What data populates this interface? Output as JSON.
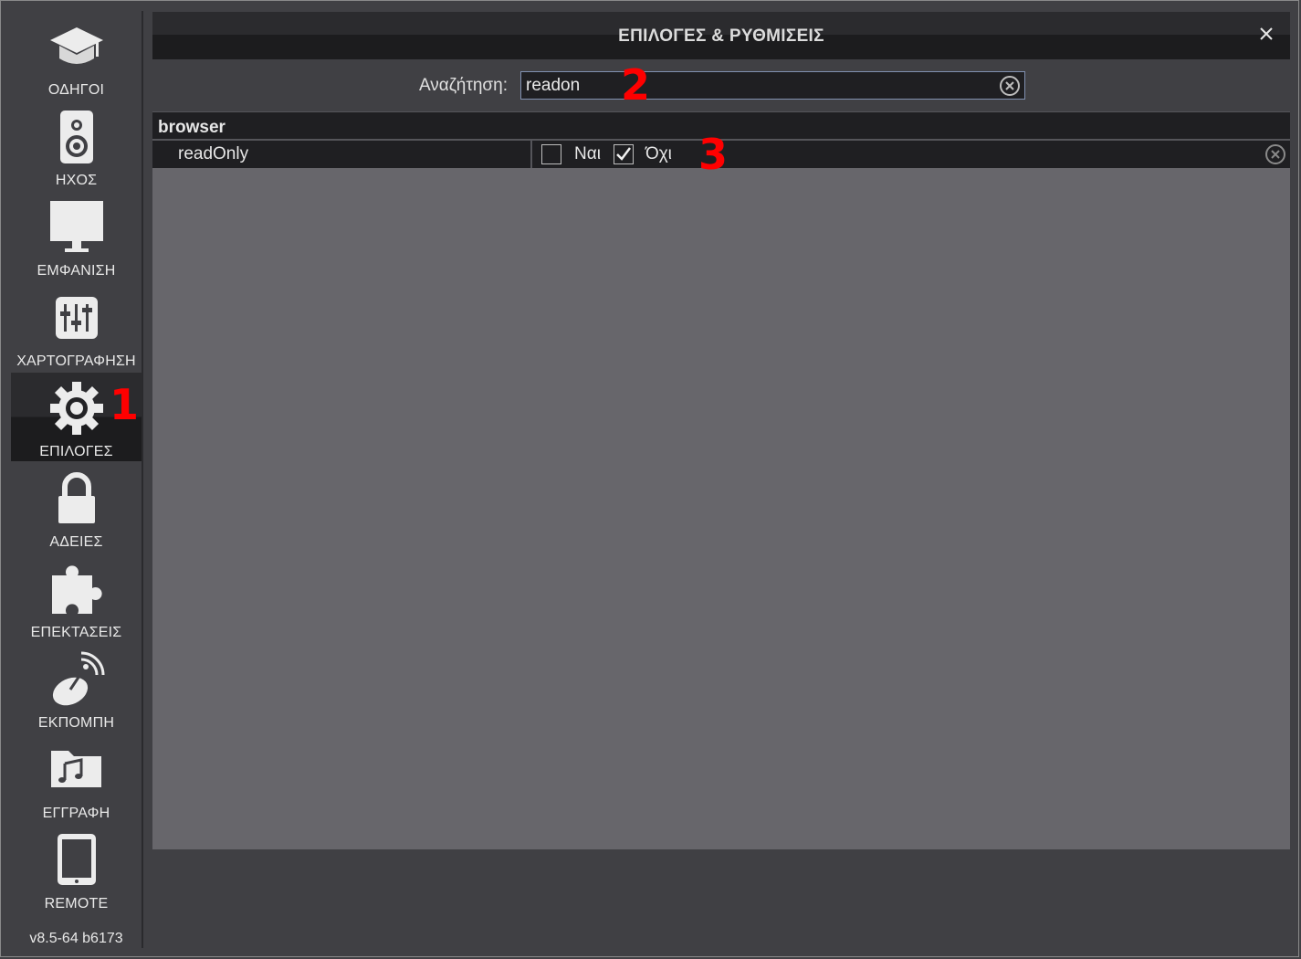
{
  "window": {
    "title": "ΕΠΙΛΟΓΕΣ & ΡΥΘΜΙΣΕΙΣ",
    "close_icon": "close-icon"
  },
  "sidebar": {
    "items": [
      {
        "label": "ΟΔΗΓΟΙ",
        "icon": "graduation-cap-icon"
      },
      {
        "label": "ΗΧΟΣ",
        "icon": "speaker-icon"
      },
      {
        "label": "ΕΜΦΑΝΙΣΗ",
        "icon": "monitor-icon"
      },
      {
        "label": "ΧΑΡΤΟΓΡΑΦΗΣΗ",
        "icon": "sliders-icon"
      },
      {
        "label": "ΕΠΙΛΟΓΕΣ",
        "icon": "gear-icon",
        "active": true
      },
      {
        "label": "ΑΔΕΙΕΣ",
        "icon": "lock-icon"
      },
      {
        "label": "ΕΠΕΚΤΑΣΕΙΣ",
        "icon": "puzzle-icon"
      },
      {
        "label": "ΕΚΠΟΜΠΗ",
        "icon": "satellite-dish-icon"
      },
      {
        "label": "ΕΓΓΡΑΦΗ",
        "icon": "music-folder-icon"
      },
      {
        "label": "REMOTE",
        "icon": "tablet-icon"
      }
    ],
    "version": "v8.5-64 b6173"
  },
  "search": {
    "label": "Αναζήτηση:",
    "value": "readon"
  },
  "results": {
    "group": "browser",
    "rows": [
      {
        "name": "readOnly",
        "option_yes": "Ναι",
        "option_no": "Όχι",
        "yes_checked": false,
        "no_checked": true
      }
    ]
  },
  "annotations": {
    "marker_1": "1",
    "marker_2": "2",
    "marker_3": "3",
    "color": "#ff0000"
  },
  "colors": {
    "background": "#404044",
    "panel": "#67666b",
    "row": "#1f1f22",
    "search_border": "#8090b0"
  }
}
